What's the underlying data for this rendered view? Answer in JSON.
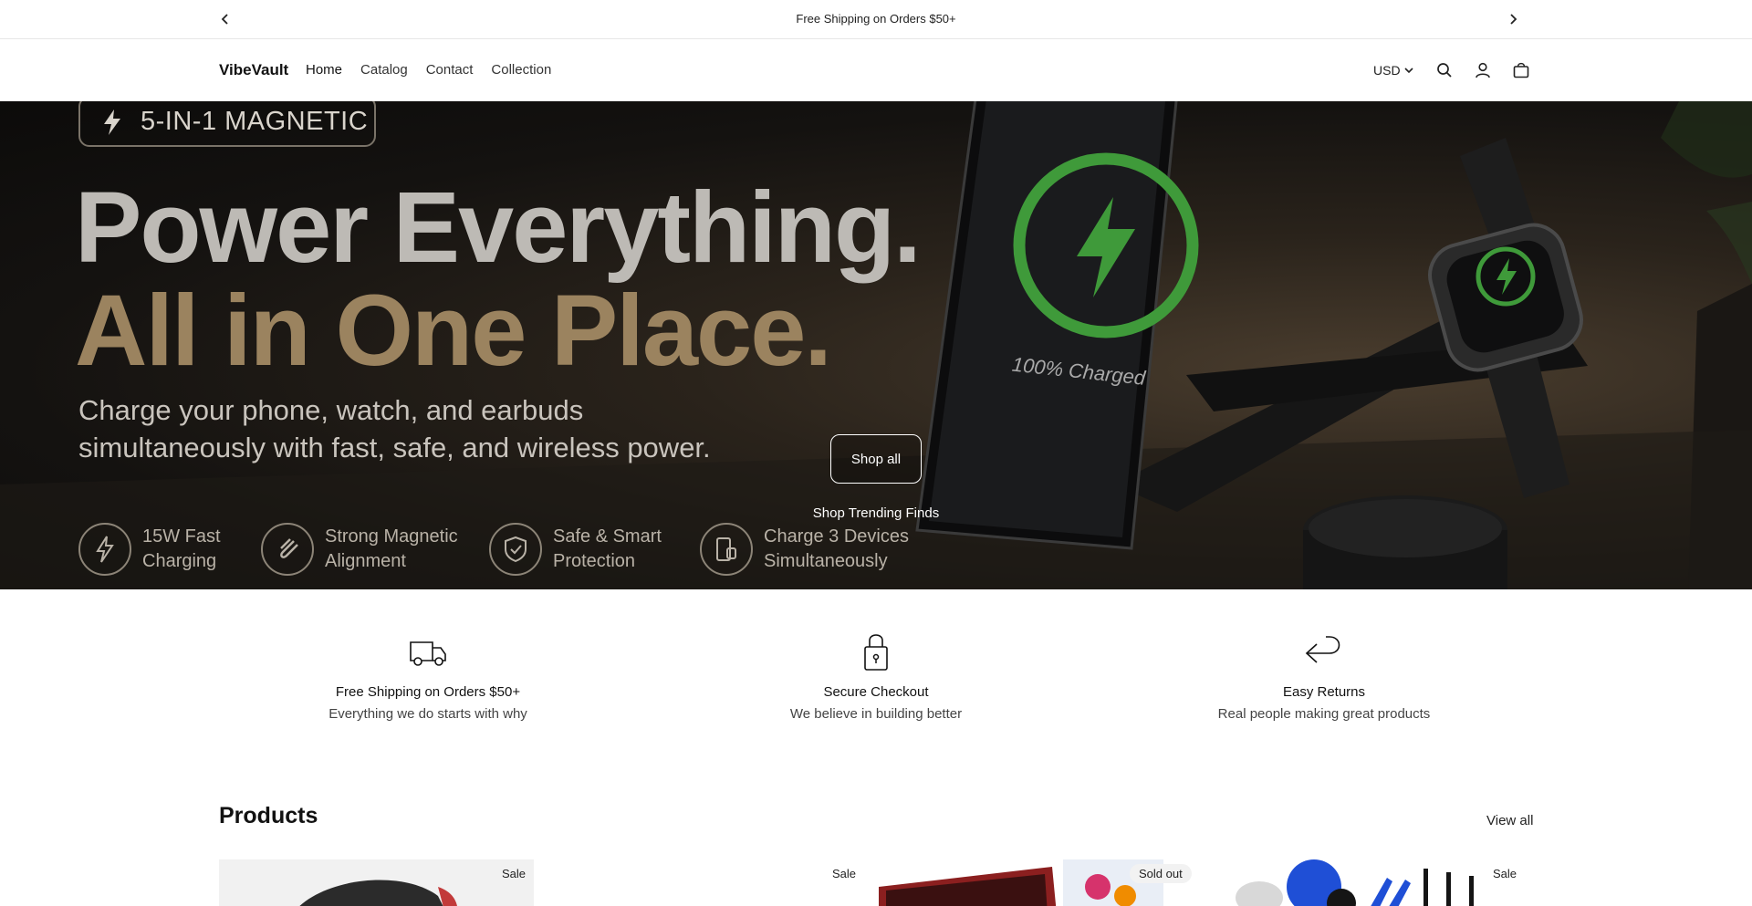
{
  "announcement": {
    "text": "Free Shipping on Orders $50+"
  },
  "header": {
    "logo": "VibeVault",
    "nav": [
      "Home",
      "Catalog",
      "Contact",
      "Collection"
    ],
    "currency": "USD"
  },
  "hero": {
    "badge": "5-IN-1 MAGNETIC",
    "headline_line1": "Power Everything.",
    "headline_line2": "All in One Place.",
    "subtitle": "Charge your phone, watch, and earbuds simultaneously with fast, safe, and wireless power.",
    "charged_label": "100% Charged",
    "features": [
      {
        "line1": "15W Fast",
        "line2": "Charging",
        "icon": "bolt-icon"
      },
      {
        "line1": "Strong Magnetic",
        "line2": "Alignment",
        "icon": "magnet-icon"
      },
      {
        "line1": "Safe & Smart",
        "line2": "Protection",
        "icon": "shield-icon"
      },
      {
        "line1": "Charge 3 Devices",
        "line2": "Simultaneously",
        "icon": "devices-icon"
      }
    ],
    "button_label": "Shop all",
    "caption": "Shop Trending Finds"
  },
  "benefits": [
    {
      "title": "Free Shipping on Orders $50+",
      "description": "Everything we do starts with why",
      "icon": "truck-icon"
    },
    {
      "title": "Secure Checkout",
      "description": "We believe in building better",
      "icon": "lock-icon"
    },
    {
      "title": "Easy Returns",
      "description": "Real people making great products",
      "icon": "return-arrow-icon"
    }
  ],
  "products": {
    "title": "Products",
    "view_all": "View all",
    "badges": [
      "Sale",
      "Sale",
      "Sold out",
      "Sale"
    ]
  },
  "colors": {
    "hero_gold": "#9b835f",
    "charge_green": "#3f9a3a",
    "brush_blue": "#1f4fd6"
  }
}
